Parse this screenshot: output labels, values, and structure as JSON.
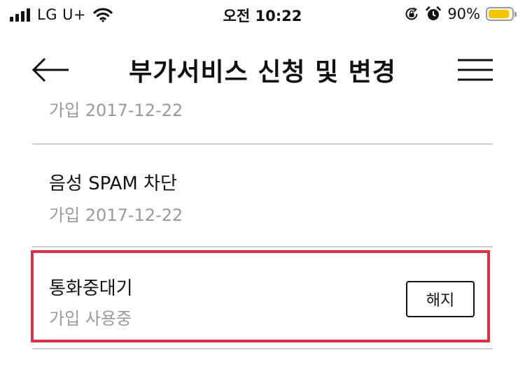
{
  "status_bar": {
    "carrier": "LG U+",
    "time": "오전 10:22",
    "battery_percent": "90%",
    "battery_level": 0.9,
    "battery_color": "#f6c500",
    "icons": [
      "signal-icon",
      "wifi-icon",
      "orientation-lock-icon",
      "alarm-icon",
      "battery-icon"
    ]
  },
  "header": {
    "title": "부가서비스 신청 및 변경",
    "back_icon": "back-arrow-icon",
    "menu_icon": "hamburger-menu-icon"
  },
  "services": [
    {
      "name": "",
      "status": "가입 2017-12-22"
    },
    {
      "name": "음성 SPAM 차단",
      "status": "가입 2017-12-22"
    },
    {
      "name": "통화중대기",
      "status": "가입 사용중",
      "action_label": "해지",
      "highlighted": true
    }
  ],
  "colors": {
    "highlight": "#e03041",
    "secondary_text": "#9a9a9a",
    "divider": "#cfcfcf"
  }
}
